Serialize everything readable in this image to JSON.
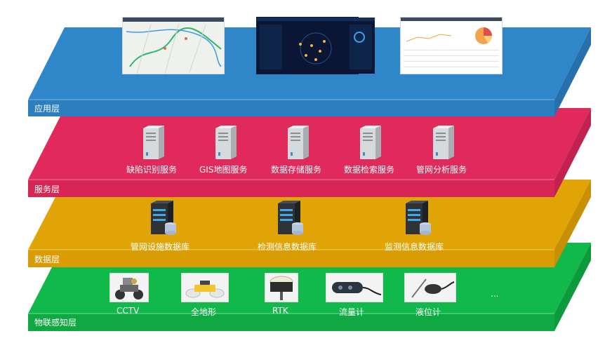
{
  "layers": {
    "application": {
      "title": "应用层"
    },
    "service": {
      "title": "服务层",
      "items": [
        "缺陷识别服务",
        "GIS地图服务",
        "数据存储服务",
        "数据检索服务",
        "管网分析服务"
      ]
    },
    "data": {
      "title": "数据层",
      "items": [
        "管网设施数据库",
        "检测信息数据库",
        "监测信息数据库"
      ]
    },
    "iot": {
      "title": "物联感知层",
      "items": [
        "CCTV",
        "全地形",
        "RTK",
        "流量计",
        "液位计"
      ],
      "more": "..."
    }
  },
  "colors": {
    "application": "#2f86c8",
    "service": "#e02a5b",
    "data": "#e0a406",
    "iot": "#11b84a"
  }
}
